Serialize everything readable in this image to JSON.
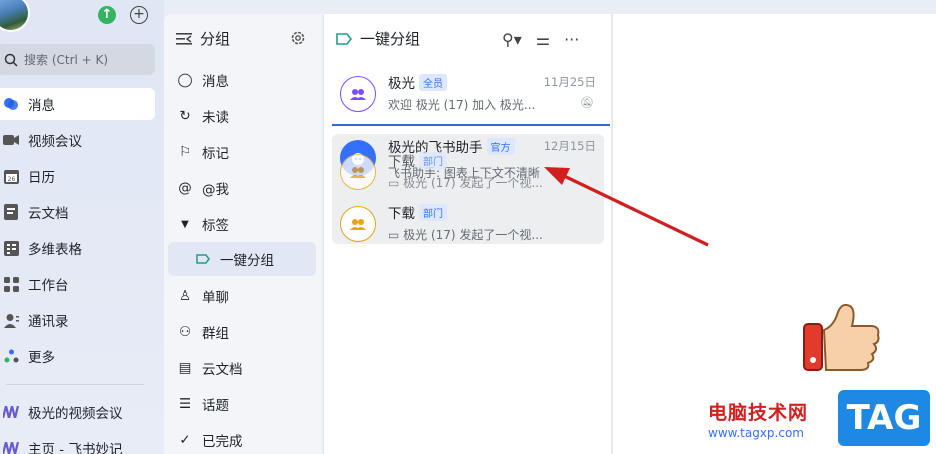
{
  "rail": {
    "search_placeholder": "搜索 (Ctrl + K)",
    "items": [
      {
        "label": "消息",
        "icon": "chat-bubble-icon"
      },
      {
        "label": "视频会议",
        "icon": "video-camera-icon"
      },
      {
        "label": "日历",
        "icon": "calendar-icon"
      },
      {
        "label": "云文档",
        "icon": "cloud-doc-icon"
      },
      {
        "label": "多维表格",
        "icon": "table-icon"
      },
      {
        "label": "工作台",
        "icon": "apps-grid-icon"
      },
      {
        "label": "通讯录",
        "icon": "contacts-icon"
      },
      {
        "label": "更多",
        "icon": "more-apps-icon"
      }
    ],
    "pinned": [
      {
        "label": "极光的视频会议"
      },
      {
        "label": "主页 - 飞书妙记"
      }
    ]
  },
  "groups": {
    "title": "分组",
    "items": [
      {
        "label": "消息"
      },
      {
        "label": "未读"
      },
      {
        "label": "标记"
      },
      {
        "label": "@我"
      },
      {
        "label": "标签"
      },
      {
        "label": "一键分组"
      },
      {
        "label": "单聊"
      },
      {
        "label": "群组"
      },
      {
        "label": "云文档"
      },
      {
        "label": "话题"
      },
      {
        "label": "已完成"
      }
    ]
  },
  "list": {
    "title": "一键分组",
    "messages": [
      {
        "name": "极光",
        "tag": "全员",
        "time": "11月25日",
        "preview": "欢迎 极光 (17) 加入 极光..."
      },
      {
        "name": "极光的飞书助手",
        "tag": "官方",
        "time": "12月15日",
        "preview": "飞书助手: 图表上下文不清晰"
      },
      {
        "name": "下载",
        "tag": "部门",
        "time": "",
        "preview": "极光 (17) 发起了一个视..."
      },
      {
        "name": "下载",
        "tag": "部门",
        "time": "",
        "preview": "极光 (17) 发起了一个视..."
      }
    ]
  },
  "watermark": {
    "site": "电脑技术网",
    "url": "www.tagxp.com",
    "badge": "TAG"
  },
  "colors": {
    "accent": "#3370ff",
    "arrow": "#d11f1f",
    "active_bg": "#ffffff"
  }
}
